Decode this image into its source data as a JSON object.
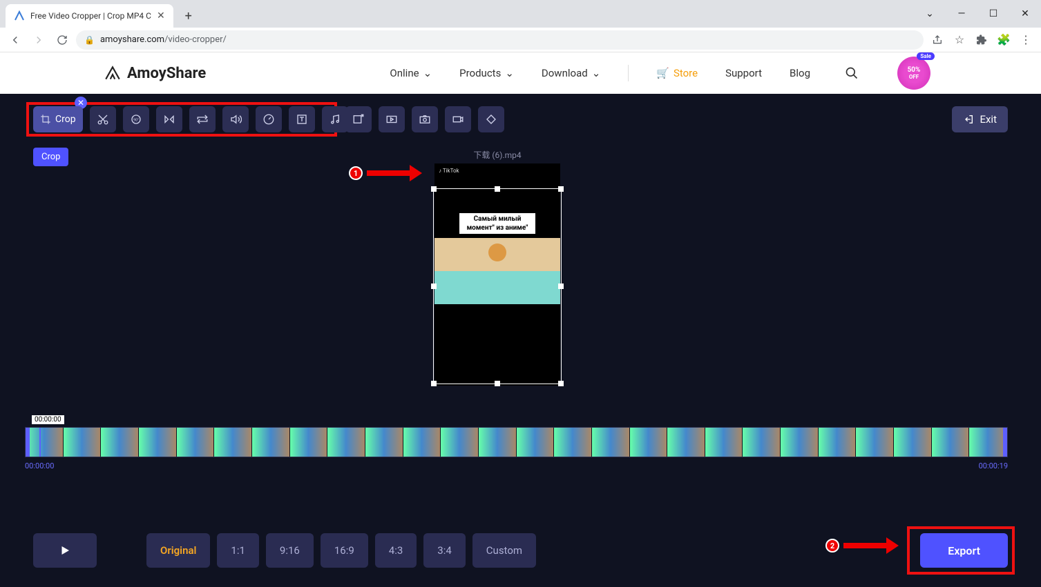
{
  "browser": {
    "tab_title": "Free Video Cropper | Crop MP4 C",
    "url_domain": "amoyshare.com",
    "url_path": "/video-cropper/"
  },
  "header": {
    "logo": "AmoyShare",
    "nav": {
      "online": "Online",
      "products": "Products",
      "download": "Download",
      "store": "Store",
      "support": "Support",
      "blog": "Blog"
    },
    "sale": {
      "percent": "50%",
      "off": "OFF"
    }
  },
  "editor": {
    "crop_label": "Crop",
    "crop_tooltip": "Crop",
    "exit": "Exit",
    "filename": "下载 (6).mp4",
    "caption_line1": "Самый милый",
    "caption_line2": "момент\" из аниме\"",
    "tiktok": "♪ TikTok",
    "timeline": {
      "current": "00:00:00",
      "start": "00:00:00",
      "end": "00:00:19"
    },
    "ratios": [
      "Original",
      "1:1",
      "9:16",
      "16:9",
      "4:3",
      "3:4",
      "Custom"
    ],
    "export": "Export"
  },
  "annotations": {
    "one": "1",
    "two": "2"
  }
}
